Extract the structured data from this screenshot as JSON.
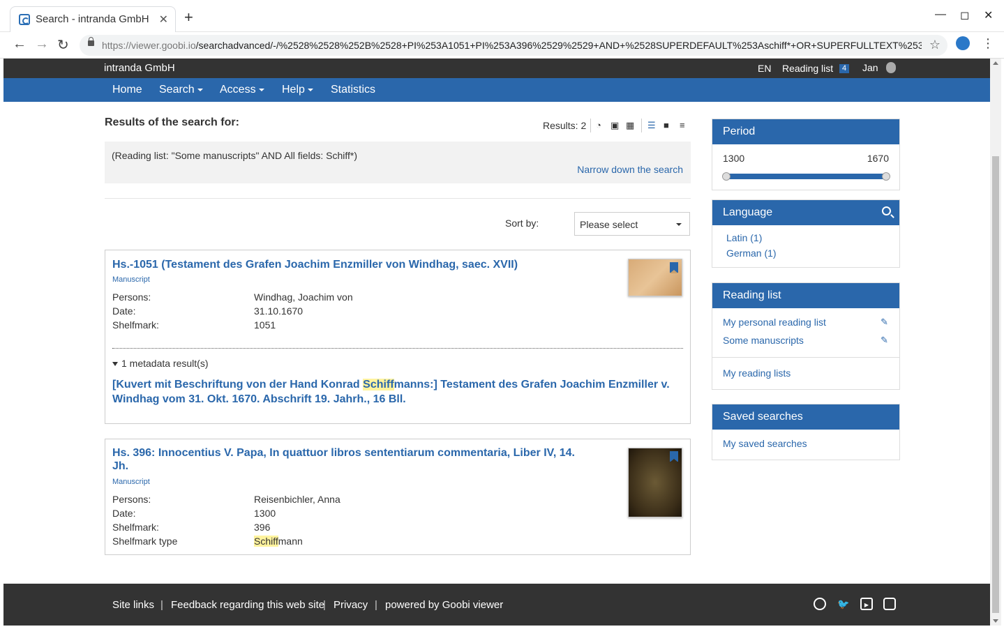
{
  "browser": {
    "tab_title": "Search - intranda GmbH",
    "url_host": "https://viewer.goobi.io",
    "url_path": "/searchadvanced/-/%2528%2528%252B%2528+PI%253A1051+PI%253A396%2529%2529+AND+%2528SUPERDEFAULT%253Aschiff*+OR+SUPERFULLTEXT%253Asc..."
  },
  "topbar": {
    "brand": "intranda GmbH",
    "language": "EN",
    "reading_list_label": "Reading list",
    "reading_list_count": "4",
    "user": "Jan"
  },
  "nav": {
    "home": "Home",
    "search": "Search",
    "access": "Access",
    "help": "Help",
    "statistics": "Statistics"
  },
  "results": {
    "heading": "Results of the search for:",
    "count_label": "Results: 2",
    "query": "(Reading list: \"Some manuscripts\" AND All fields: Schiff*)",
    "narrow": "Narrow down the search",
    "sort_label": "Sort by:",
    "sort_value": "Please select"
  },
  "hits": [
    {
      "title": "Hs.-1051 (Testament des Grafen Joachim Enzmiller von Windhag, saec. XVII)",
      "type": "Manuscript",
      "persons_label": "Persons:",
      "persons": "Windhag, Joachim von",
      "date_label": "Date:",
      "date": "31.10.1670",
      "shelfmark_label": "Shelfmark:",
      "shelfmark": "1051",
      "meta_results": "1 metadata result(s)",
      "hit_pre": "[Kuvert mit Beschriftung von der Hand Konrad ",
      "hit_mark": "Schiff",
      "hit_post": "manns:] Testament des Grafen Joachim Enzmiller v. Windhag vom 31. Okt. 1670. Abschrift 19. Jahrh., 16 Bll."
    },
    {
      "title": "Hs. 396: Innocentius V. Papa, In quattuor libros sententiarum commentaria, Liber IV, 14. Jh.",
      "type": "Manuscript",
      "persons_label": "Persons:",
      "persons": "Reisenbichler, Anna",
      "date_label": "Date:",
      "date": "1300",
      "shelfmark_label": "Shelfmark:",
      "shelfmark": "396",
      "shelfmark_type_label": "Shelfmark type",
      "shelfmark_type_mark": "Schiff",
      "shelfmark_type_rest": "mann"
    }
  ],
  "sidebar": {
    "period": {
      "title": "Period",
      "from": "1300",
      "to": "1670"
    },
    "language": {
      "title": "Language",
      "items": [
        "Latin (1)",
        "German (1)"
      ]
    },
    "reading_list": {
      "title": "Reading list",
      "items": [
        "My personal reading list",
        "Some manuscripts"
      ],
      "all": "My reading lists"
    },
    "saved_searches": {
      "title": "Saved searches",
      "link": "My saved searches"
    }
  },
  "footer": {
    "site_links": "Site links",
    "feedback": "Feedback regarding this web site",
    "privacy": "Privacy",
    "powered": "powered by Goobi viewer",
    "separator": "|"
  },
  "colors": {
    "brand_blue": "#2a67ab",
    "dark_bar": "#333333",
    "highlight": "#fff39d"
  }
}
